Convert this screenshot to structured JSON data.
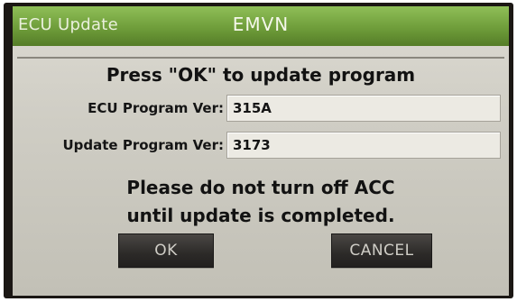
{
  "header": {
    "left_title": "ECU Update",
    "center_title": "EMVN"
  },
  "dialog": {
    "prompt": "Press \"OK\" to update program",
    "fields": [
      {
        "label": "ECU Program Ver:",
        "value": "315A"
      },
      {
        "label": "Update Program Ver:",
        "value": "3173"
      }
    ],
    "warning_line1": "Please do not turn off ACC",
    "warning_line2": "until update is completed.",
    "ok_label": "OK",
    "cancel_label": "CANCEL"
  },
  "colors": {
    "titlebar": "#6f9d3a",
    "background": "#cfcdc4",
    "button": "#2c2a28"
  }
}
